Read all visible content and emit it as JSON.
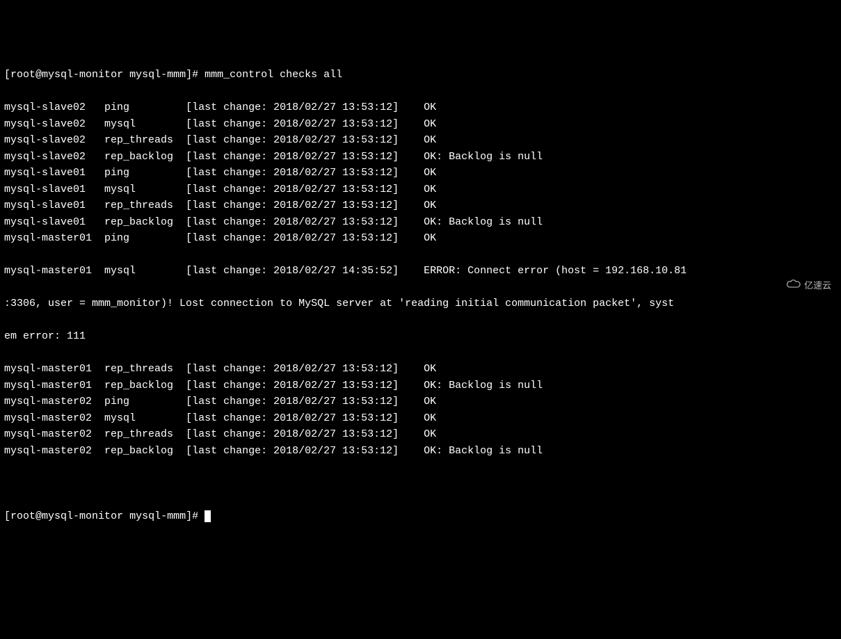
{
  "prompt1": {
    "open": "[",
    "user": "root",
    "at": "@",
    "host": "mysql-monitor",
    "space": " ",
    "cwd": "mysql-mmm",
    "close": "]#",
    "space2": " ",
    "command": "mmm_control checks all"
  },
  "rows": [
    {
      "host": "mysql-slave02",
      "check": "ping",
      "lc": "[last change: 2018/02/27 13:53:12]",
      "status": "OK"
    },
    {
      "host": "mysql-slave02",
      "check": "mysql",
      "lc": "[last change: 2018/02/27 13:53:12]",
      "status": "OK"
    },
    {
      "host": "mysql-slave02",
      "check": "rep_threads",
      "lc": "[last change: 2018/02/27 13:53:12]",
      "status": "OK"
    },
    {
      "host": "mysql-slave02",
      "check": "rep_backlog",
      "lc": "[last change: 2018/02/27 13:53:12]",
      "status": "OK: Backlog is null"
    },
    {
      "host": "mysql-slave01",
      "check": "ping",
      "lc": "[last change: 2018/02/27 13:53:12]",
      "status": "OK"
    },
    {
      "host": "mysql-slave01",
      "check": "mysql",
      "lc": "[last change: 2018/02/27 13:53:12]",
      "status": "OK"
    },
    {
      "host": "mysql-slave01",
      "check": "rep_threads",
      "lc": "[last change: 2018/02/27 13:53:12]",
      "status": "OK"
    },
    {
      "host": "mysql-slave01",
      "check": "rep_backlog",
      "lc": "[last change: 2018/02/27 13:53:12]",
      "status": "OK: Backlog is null"
    },
    {
      "host": "mysql-master01",
      "check": "ping",
      "lc": "[last change: 2018/02/27 13:53:12]",
      "status": "OK"
    }
  ],
  "error": {
    "line1_host": "mysql-master01",
    "line1_check": "mysql",
    "line1_lc": "[last change: 2018/02/27 14:35:52]",
    "line1_status": "ERROR: Connect error (host = 192.168.10.81",
    "line2": ":3306, user = mmm_monitor)! Lost connection to MySQL server at 'reading initial communication packet', syst",
    "line3": "em error: 111"
  },
  "rows2": [
    {
      "host": "mysql-master01",
      "check": "rep_threads",
      "lc": "[last change: 2018/02/27 13:53:12]",
      "status": "OK"
    },
    {
      "host": "mysql-master01",
      "check": "rep_backlog",
      "lc": "[last change: 2018/02/27 13:53:12]",
      "status": "OK: Backlog is null"
    },
    {
      "host": "mysql-master02",
      "check": "ping",
      "lc": "[last change: 2018/02/27 13:53:12]",
      "status": "OK"
    },
    {
      "host": "mysql-master02",
      "check": "mysql",
      "lc": "[last change: 2018/02/27 13:53:12]",
      "status": "OK"
    },
    {
      "host": "mysql-master02",
      "check": "rep_threads",
      "lc": "[last change: 2018/02/27 13:53:12]",
      "status": "OK"
    },
    {
      "host": "mysql-master02",
      "check": "rep_backlog",
      "lc": "[last change: 2018/02/27 13:53:12]",
      "status": "OK: Backlog is null"
    }
  ],
  "prompt2": {
    "open": "[",
    "user": "root",
    "at": "@",
    "host": "mysql-monitor",
    "space": " ",
    "cwd": "mysql-mmm",
    "close": "]#",
    "space2": " "
  },
  "watermark": "亿速云",
  "cols": {
    "host": 16,
    "check": 13,
    "lc": 38
  }
}
